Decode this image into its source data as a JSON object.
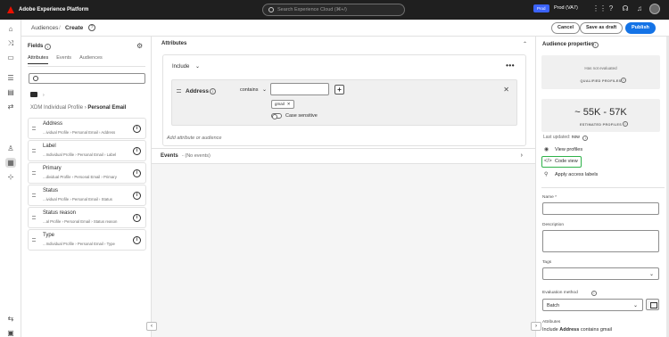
{
  "app": {
    "title": "Adobe Experience Platform"
  },
  "search": {
    "placeholder": "Search Experience Cloud (⌘+/)"
  },
  "sandbox": {
    "badge": "Prod",
    "name": "Prod (VA7)"
  },
  "breadcrumb": {
    "root": "Audiences",
    "separator": "/",
    "current": "Create",
    "help": "?"
  },
  "header_buttons": {
    "cancel": "Cancel",
    "save_draft": "Save as draft",
    "publish": "Publish"
  },
  "fields_panel": {
    "title": "Fields",
    "tabs": [
      "Attributes",
      "Events",
      "Audiences"
    ],
    "path_chevron": "›",
    "path_root": "XDM Individual Profile",
    "path_separator": "›",
    "path_current": "Personal Email",
    "items": [
      {
        "name": "Address",
        "path": "...ividual Profile › Personal Email › Address"
      },
      {
        "name": "Label",
        "path": "...Individual Profile › Personal Email › Label"
      },
      {
        "name": "Primary",
        "path": "...dividual Profile › Personal Email › Primary"
      },
      {
        "name": "Status",
        "path": "...ividual Profile › Personal Email › Status"
      },
      {
        "name": "Status reason",
        "path": "...al Profile › Personal Email › Status reason"
      },
      {
        "name": "Type",
        "path": "...Individual Profile › Personal Email › Type"
      }
    ]
  },
  "canvas": {
    "attributes_title": "Attributes",
    "include_label": "Include",
    "more": "•••",
    "rule": {
      "attribute": "Address",
      "operator": "contains",
      "value_chip": "gmail",
      "toggle_label": "Case sensitive"
    },
    "add_placeholder": "Add attribute or audience",
    "events_title": "Events",
    "events_note": "- (No events)"
  },
  "properties": {
    "title": "Audience properties",
    "qualified_status": "Has not evaluated",
    "qualified_label": "QUALIFIED PROFILES",
    "estimate": "~ 55K - 57K",
    "estimated_label": "ESTIMATED PROFILES",
    "last_updated_label": "Last updated:",
    "last_updated_value": "now",
    "view_profiles": "View profiles",
    "code_view": "Code view",
    "apply_labels": "Apply access labels",
    "name_label": "Name",
    "required_mark": "*",
    "description_label": "Description",
    "tags_label": "Tags",
    "evaluation_label": "Evaluation method",
    "evaluation_value": "Batch",
    "attributes_label": "Attributes",
    "summary_prefix": "Include",
    "summary_attr": "Address",
    "summary_rest": "contains gmail"
  },
  "colors": {
    "accent": "#1473e6",
    "highlight": "#2fb24a",
    "topbar": "#1f1f1f",
    "logo": "#eb1000"
  }
}
